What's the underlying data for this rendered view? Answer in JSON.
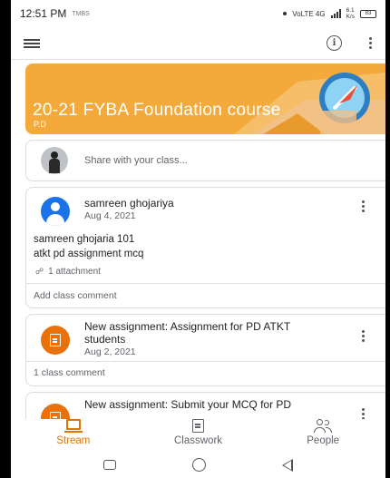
{
  "status_bar": {
    "time": "12:51 PM",
    "small_label": "TMBS",
    "network": "VoLTE 4G",
    "speed_top": "6.1",
    "speed_unit": "K/s",
    "battery": "83"
  },
  "class": {
    "title": "20-21 FYBA Foundation course",
    "section": "P.D",
    "banner_color": "#f4a93b"
  },
  "share": {
    "placeholder": "Share with your class..."
  },
  "post": {
    "author": "samreen ghojariya",
    "date": "Aug 4, 2021",
    "line1": "samreen ghojaria 101",
    "line2": "atkt pd assignment mcq",
    "attachments": "1 attachment",
    "comment_placeholder": "Add class comment"
  },
  "assignments": [
    {
      "title": "New assignment: Assignment for PD ATKT students",
      "date": "Aug 2, 2021",
      "comments": "1 class comment"
    },
    {
      "title": "New assignment: Submit your MCQ for PD"
    }
  ],
  "bottom_nav": {
    "stream": "Stream",
    "classwork": "Classwork",
    "people": "People",
    "active_color": "#e37400"
  },
  "icons": {
    "menu": "hamburger-icon",
    "info": "info-icon",
    "more": "kebab-icon",
    "attachment": "paperclip-icon",
    "assignment": "assignment-doc-icon"
  }
}
